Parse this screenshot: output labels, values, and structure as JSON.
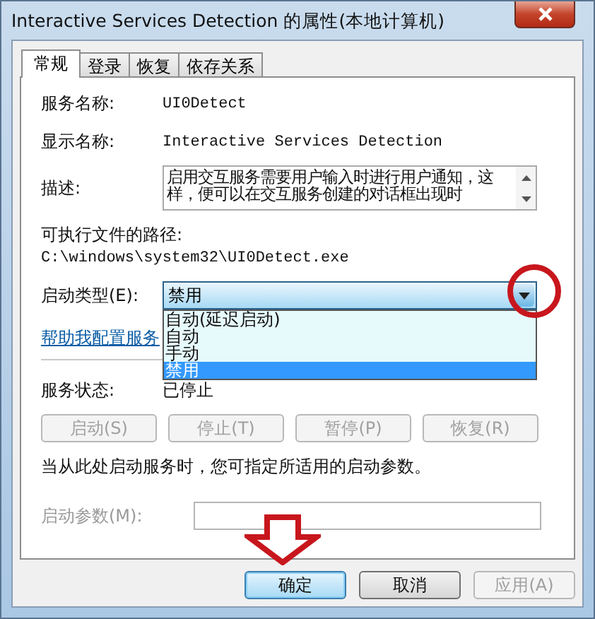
{
  "window": {
    "title": "Interactive Services Detection 的属性(本地计算机)"
  },
  "tabs": [
    {
      "label": "常规",
      "selected": true
    },
    {
      "label": "登录",
      "selected": false
    },
    {
      "label": "恢复",
      "selected": false
    },
    {
      "label": "依存关系",
      "selected": false
    }
  ],
  "service_name": {
    "label": "服务名称:",
    "value": "UI0Detect"
  },
  "display_name": {
    "label": "显示名称:",
    "value": "Interactive Services Detection"
  },
  "description": {
    "label": "描述:",
    "value": "启用交互服务需要用户输入时进行用户通知，这样，便可以在交互服务创建的对话框出现时"
  },
  "path": {
    "label": "可执行文件的路径:",
    "value": "C:\\windows\\system32\\UI0Detect.exe"
  },
  "startup_type": {
    "label": "启动类型(E):",
    "value": "禁用",
    "expanded": true,
    "options": [
      {
        "label": "自动(延迟启动)",
        "selected": false
      },
      {
        "label": "自动",
        "selected": false
      },
      {
        "label": "手动",
        "selected": false
      },
      {
        "label": "禁用",
        "selected": true
      }
    ]
  },
  "help_link": "帮助我配置服务",
  "service_status": {
    "label": "服务状态:",
    "value": "已停止"
  },
  "service_buttons": [
    {
      "label": "启动(S)",
      "disabled": true
    },
    {
      "label": "停止(T)",
      "disabled": true
    },
    {
      "label": "暂停(P)",
      "disabled": true
    },
    {
      "label": "恢复(R)",
      "disabled": true
    }
  ],
  "note": "当从此处启动服务时，您可指定所适用的启动参数。",
  "start_params": {
    "label": "启动参数(M):",
    "disabled": true
  },
  "dialog_buttons": [
    {
      "label": "确定",
      "disabled": false,
      "default": true
    },
    {
      "label": "取消",
      "disabled": false,
      "default": false
    },
    {
      "label": "应用(A)",
      "disabled": true,
      "default": false
    }
  ]
}
